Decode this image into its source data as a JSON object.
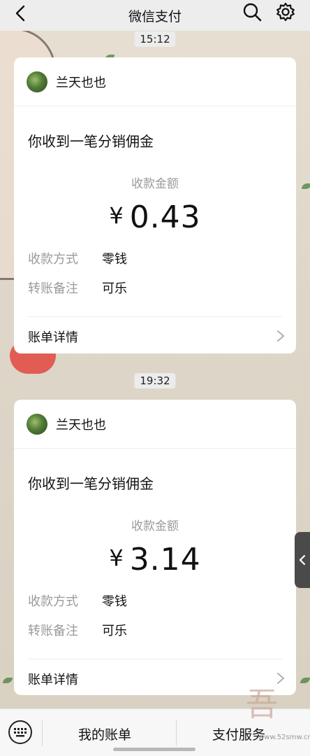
{
  "header": {
    "title": "微信支付"
  },
  "messages": [
    {
      "time": "15:12",
      "sender": "兰天也也",
      "title": "你收到一笔分销佣金",
      "amount_label": "收款金额",
      "currency": "¥",
      "amount": "0.43",
      "rows": [
        {
          "key": "收款方式",
          "value": "零钱"
        },
        {
          "key": "转账备注",
          "value": "可乐"
        }
      ],
      "footer": "账单详情"
    },
    {
      "time": "19:32",
      "sender": "兰天也也",
      "title": "你收到一笔分销佣金",
      "amount_label": "收款金额",
      "currency": "¥",
      "amount": "3.14",
      "rows": [
        {
          "key": "收款方式",
          "value": "零钱"
        },
        {
          "key": "转账备注",
          "value": "可乐"
        }
      ],
      "footer": "账单详情"
    }
  ],
  "bottom": {
    "tab1": "我的账单",
    "tab2": "支付服务"
  },
  "watermark": {
    "text": "www.52smw.cn",
    "glyph": "吾"
  },
  "icons": {
    "back": "chevron-left-icon",
    "search": "search-icon",
    "settings": "gear-icon",
    "keyboard": "keyboard-icon",
    "side": "chevron-left-icon"
  }
}
